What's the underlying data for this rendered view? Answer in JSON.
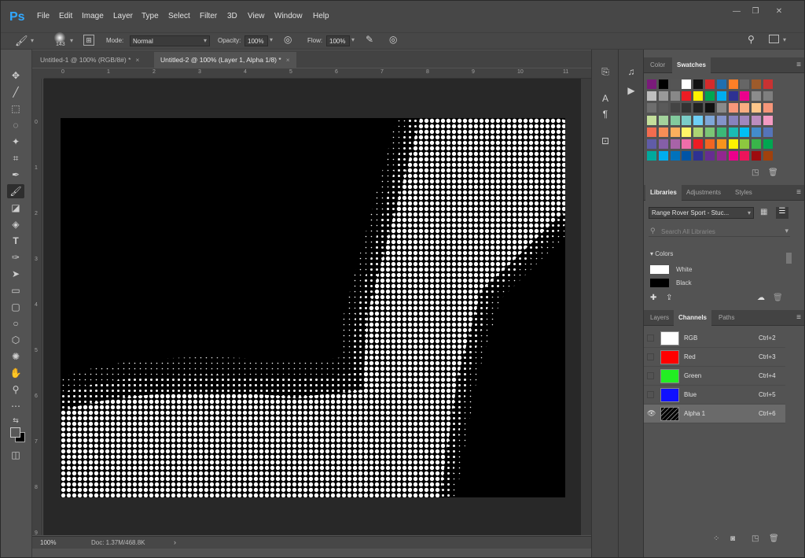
{
  "app": {
    "logo": "Ps"
  },
  "menu": [
    "File",
    "Edit",
    "Image",
    "Layer",
    "Type",
    "Select",
    "Filter",
    "3D",
    "View",
    "Window",
    "Help"
  ],
  "window_controls": {
    "minimize": "—",
    "restore": "❐",
    "close": "✕"
  },
  "options": {
    "brush_size": "143",
    "mode_label": "Mode:",
    "mode_value": "Normal",
    "opacity_label": "Opacity:",
    "opacity_value": "100%",
    "flow_label": "Flow:",
    "flow_value": "100%"
  },
  "tabs": [
    {
      "label": "Untitled-1 @ 100% (RGB/8#) *",
      "close": "×"
    },
    {
      "label": "Untitled-2 @ 100% (Layer 1, Alpha 1/8) *",
      "close": "×"
    }
  ],
  "ruler": {
    "top": [
      "0",
      "1",
      "2",
      "3",
      "4",
      "5",
      "6",
      "7",
      "8",
      "9",
      "10",
      "11"
    ],
    "left": [
      "0",
      "1",
      "2",
      "3",
      "4",
      "5",
      "6",
      "7",
      "8",
      "9"
    ]
  },
  "status": {
    "zoom": "100%",
    "doc": "Doc: 1.37M/468.8K",
    "arrow": "›"
  },
  "panels": {
    "color_tabs": [
      "Color",
      "Swatches"
    ],
    "libraries_tabs": [
      "Libraries",
      "Adjustments",
      "Styles"
    ],
    "library_name": "Range Rover Sport - Stuc...",
    "library_search_placeholder": "Search All Libraries",
    "colors_section": "Colors",
    "colors": [
      {
        "name": "White",
        "hex": "#ffffff"
      },
      {
        "name": "Black",
        "hex": "#000000"
      }
    ],
    "layers_tabs": [
      "Layers",
      "Channels",
      "Paths"
    ],
    "channels": [
      {
        "name": "RGB",
        "key": "Ctrl+2",
        "color": "#ffffff"
      },
      {
        "name": "Red",
        "key": "Ctrl+3",
        "color": "#ff0000"
      },
      {
        "name": "Green",
        "key": "Ctrl+4",
        "color": "#22ee22"
      },
      {
        "name": "Blue",
        "key": "Ctrl+5",
        "color": "#1010ff"
      },
      {
        "name": "Alpha 1",
        "key": "Ctrl+6",
        "color": "#000000"
      }
    ]
  },
  "swatch_rows": [
    [
      "#7a1b7a",
      "#000000",
      "#555555",
      "#ffffff",
      "#111111",
      "#d42b2b",
      "#1f6fb0",
      "#ff7f27",
      "#666666",
      "#9e5b2b",
      "#c83232"
    ],
    [
      "#bfbfbf",
      "#9a9a9a",
      "#888888",
      "#ed1c24",
      "#fff200",
      "#00a651",
      "#00aeef",
      "#2e3192",
      "#ec008c",
      "#8c8c8c",
      "#7f7f7f"
    ],
    [
      "#6e6e6e",
      "#5a5a5a",
      "#444444",
      "#333333",
      "#222222",
      "#111111",
      "#8a8a8a",
      "#f7977a",
      "#f9ad81",
      "#fdc68a",
      "#f69679"
    ],
    [
      "#c4df9b",
      "#a3d39c",
      "#82ca9d",
      "#7bcdc8",
      "#6ecff6",
      "#7ea7d8",
      "#8493ca",
      "#8882be",
      "#a187be",
      "#bc8dbf",
      "#f49ac2"
    ],
    [
      "#f26c4f",
      "#f68e56",
      "#fbaf5d",
      "#fff568",
      "#acd373",
      "#7cc576",
      "#3bb878",
      "#1abbb4",
      "#00bff3",
      "#438ccb",
      "#5574b9"
    ],
    [
      "#605ca8",
      "#855fa8",
      "#a763a8",
      "#f06eaa",
      "#ed1c24",
      "#f26522",
      "#f7941d",
      "#fff200",
      "#8dc73f",
      "#39b54a",
      "#00a651"
    ],
    [
      "#00a99d",
      "#00aeef",
      "#0072bc",
      "#0054a6",
      "#2e3192",
      "#662d91",
      "#92278f",
      "#ec008c",
      "#ed145b",
      "#9e0b0f",
      "#a0410d"
    ]
  ]
}
